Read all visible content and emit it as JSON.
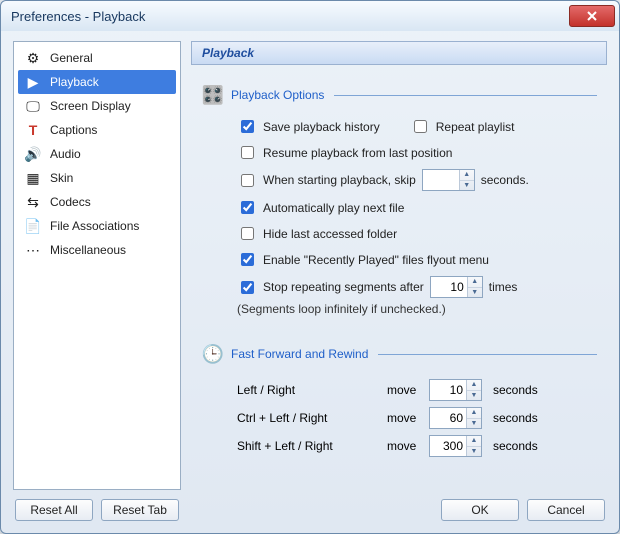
{
  "window": {
    "title": "Preferences - Playback"
  },
  "sidebar": {
    "items": [
      {
        "label": "General",
        "icon": "⚙"
      },
      {
        "label": "Playback",
        "icon": "▶"
      },
      {
        "label": "Screen Display",
        "icon": "🖵"
      },
      {
        "label": "Captions",
        "icon": "T"
      },
      {
        "label": "Audio",
        "icon": "🔊"
      },
      {
        "label": "Skin",
        "icon": "▦"
      },
      {
        "label": "Codecs",
        "icon": "⇆"
      },
      {
        "label": "File Associations",
        "icon": "📄"
      },
      {
        "label": "Miscellaneous",
        "icon": "⋯"
      }
    ],
    "active_index": 1
  },
  "page": {
    "title": "Playback",
    "playback_options": {
      "legend": "Playback Options",
      "save_history": {
        "label": "Save playback history",
        "checked": true
      },
      "repeat_playlist": {
        "label": "Repeat playlist",
        "checked": false
      },
      "resume_from_last": {
        "label": "Resume playback from last position",
        "checked": false
      },
      "skip_on_start": {
        "label_prefix": "When starting playback, skip",
        "value": "",
        "label_suffix": "seconds.",
        "checked": false
      },
      "auto_play_next": {
        "label": "Automatically play next file",
        "checked": true
      },
      "hide_last_folder": {
        "label": "Hide last accessed folder",
        "checked": false
      },
      "enable_recent_flyout": {
        "label": "Enable \"Recently Played\" files flyout menu",
        "checked": true
      },
      "stop_repeating": {
        "label_prefix": "Stop repeating segments after",
        "value": "10",
        "label_suffix": "times",
        "checked": true
      },
      "hint": "(Segments loop infinitely if unchecked.)"
    },
    "ffr": {
      "legend": "Fast Forward and Rewind",
      "move_label": "move",
      "unit": "seconds",
      "rows": [
        {
          "key": "Left / Right",
          "value": "10"
        },
        {
          "key": "Ctrl + Left / Right",
          "value": "60"
        },
        {
          "key": "Shift + Left / Right",
          "value": "300"
        }
      ]
    }
  },
  "footer": {
    "reset_all": "Reset All",
    "reset_tab": "Reset Tab",
    "ok": "OK",
    "cancel": "Cancel"
  },
  "colors": {
    "accent": "#3e7de0",
    "link_blue": "#1f5fc9"
  }
}
